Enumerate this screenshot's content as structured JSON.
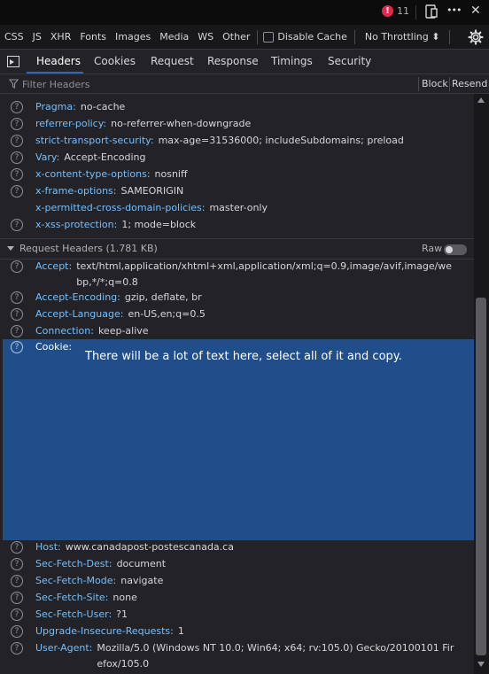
{
  "topbar": {
    "error_count": "11",
    "error_glyph": "!",
    "icons": [
      "responsive-design-icon",
      "more-options-icon",
      "close-icon"
    ],
    "more_glyph": "•••",
    "close_glyph": "✕"
  },
  "filterbar": {
    "types": [
      "CSS",
      "JS",
      "XHR",
      "Fonts",
      "Images",
      "Media",
      "WS",
      "Other"
    ],
    "disable_cache_label": "Disable Cache",
    "throttling_label": "No Throttling ⬍"
  },
  "tabs": {
    "items": [
      "Headers",
      "Cookies",
      "Request",
      "Response",
      "Timings",
      "Security"
    ],
    "active": "Headers"
  },
  "filter_row": {
    "placeholder": "Filter Headers",
    "block_label": "Block",
    "resend_label": "Resend"
  },
  "response_headers": [
    {
      "name": "Pragma:",
      "value": "no-cache",
      "icon": true
    },
    {
      "name": "referrer-policy:",
      "value": "no-referrer-when-downgrade",
      "icon": true
    },
    {
      "name": "strict-transport-security:",
      "value": "max-age=31536000; includeSubdomains; preload",
      "icon": true
    },
    {
      "name": "Vary:",
      "value": "Accept-Encoding",
      "icon": true
    },
    {
      "name": "x-content-type-options:",
      "value": "nosniff",
      "icon": true
    },
    {
      "name": "x-frame-options:",
      "value": "SAMEORIGIN",
      "icon": true
    },
    {
      "name": "x-permitted-cross-domain-policies:",
      "value": "master-only",
      "icon": false
    },
    {
      "name": "x-xss-protection:",
      "value": "1; mode=block",
      "icon": true
    }
  ],
  "request_section": {
    "title": "Request Headers (1.781 KB)",
    "raw_label": "Raw"
  },
  "request_headers_top": [
    {
      "name": "Accept:",
      "value": "text/html,application/xhtml+xml,application/xml;q=0.9,image/avif,image/webp,*/*;q=0.8"
    },
    {
      "name": "Accept-Encoding:",
      "value": "gzip, deflate, br"
    },
    {
      "name": "Accept-Language:",
      "value": "en-US,en;q=0.5"
    },
    {
      "name": "Connection:",
      "value": "keep-alive"
    }
  ],
  "cookie": {
    "name": "Cookie:",
    "note": "There will be a lot of text here, select all of it and copy."
  },
  "request_headers_bottom": [
    {
      "name": "Host:",
      "value": "www.canadapost-postescanada.ca"
    },
    {
      "name": "Sec-Fetch-Dest:",
      "value": "document"
    },
    {
      "name": "Sec-Fetch-Mode:",
      "value": "navigate"
    },
    {
      "name": "Sec-Fetch-Site:",
      "value": "none"
    },
    {
      "name": "Sec-Fetch-User:",
      "value": "?1"
    },
    {
      "name": "Upgrade-Insecure-Requests:",
      "value": "1"
    },
    {
      "name": "User-Agent:",
      "value": "Mozilla/5.0 (Windows NT 10.0; Win64; x64; rv:105.0) Gecko/20100101 Firefox/105.0"
    }
  ],
  "help_glyph": "?",
  "colors": {
    "header_name": "#75bfff",
    "selection": "#204e8a",
    "tab_accent": "#2a6bc8",
    "error_badge": "#e22850"
  }
}
